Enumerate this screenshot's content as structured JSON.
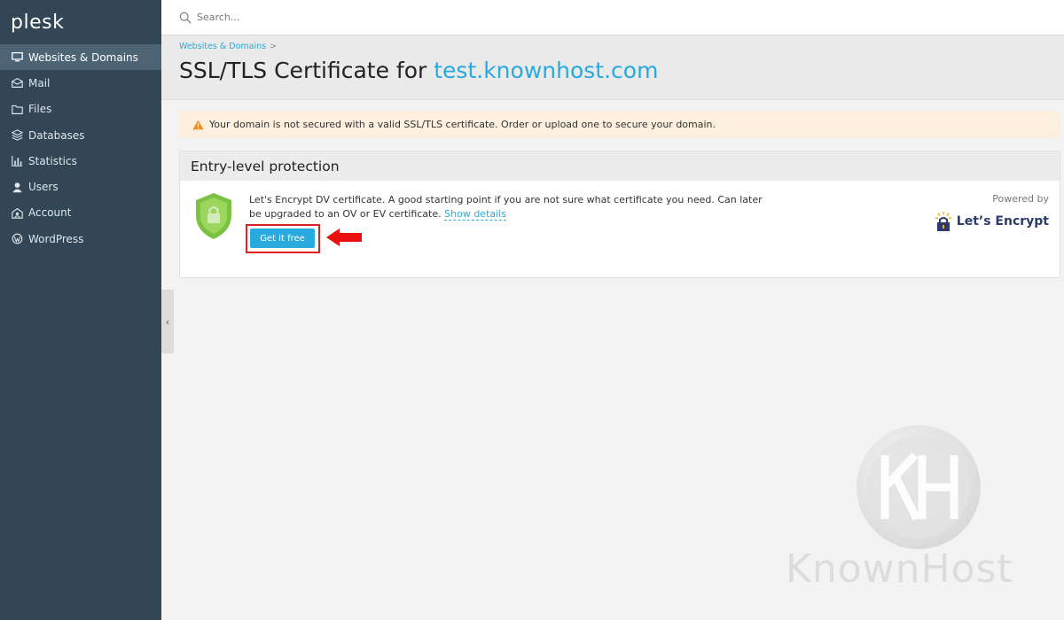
{
  "app": {
    "logo_text": "plesk"
  },
  "sidebar": {
    "items": [
      {
        "label": "Websites & Domains",
        "icon": "monitor-icon",
        "active": true
      },
      {
        "label": "Mail",
        "icon": "envelope-icon",
        "active": false
      },
      {
        "label": "Files",
        "icon": "folder-icon",
        "active": false
      },
      {
        "label": "Databases",
        "icon": "database-icon",
        "active": false
      },
      {
        "label": "Statistics",
        "icon": "bar-chart-icon",
        "active": false
      },
      {
        "label": "Users",
        "icon": "user-icon",
        "active": false
      },
      {
        "label": "Account",
        "icon": "account-icon",
        "active": false
      },
      {
        "label": "WordPress",
        "icon": "wordpress-icon",
        "active": false
      }
    ]
  },
  "search": {
    "placeholder": "Search..."
  },
  "header": {
    "breadcrumb": "Websites & Domains",
    "breadcrumb_sep": ">",
    "title_prefix": "SSL/TLS Certificate for",
    "title_domain": "test.knownhost.com"
  },
  "warning": {
    "text": "Your domain is not secured with a valid SSL/TLS certificate. Order or upload one to secure your domain."
  },
  "panel": {
    "title": "Entry-level protection",
    "description": "Let's Encrypt DV certificate. A good starting point if you are not sure what certificate you need. Can later be upgraded to an OV or EV certificate.",
    "show_details": "Show details",
    "button_label": "Get it free",
    "powered_by": "Powered by",
    "provider": "Let’s Encrypt"
  },
  "watermark": {
    "text": "KnownHost"
  },
  "colors": {
    "accent": "#28aade",
    "sidebar_bg": "#324656",
    "warning_bg": "#fcefdd",
    "highlight": "#e02020"
  }
}
